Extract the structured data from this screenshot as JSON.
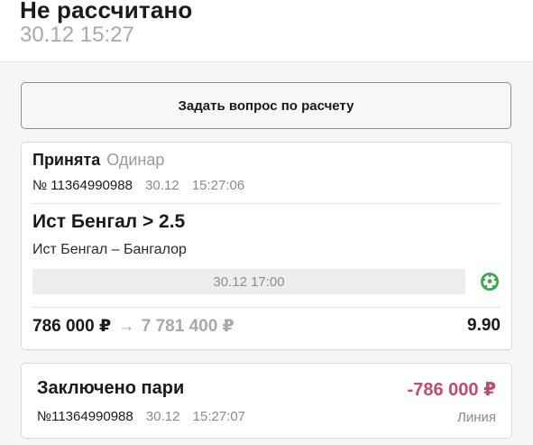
{
  "header": {
    "status_title": "Не рассчитано",
    "status_time": "30.12 15:27"
  },
  "ask_button": {
    "label": "Задать вопрос по расчету"
  },
  "bet": {
    "accepted_label": "Принята",
    "bet_type": "Одинар",
    "number": "№ 11364990988",
    "date": "30.12",
    "time": "15:27:06",
    "selection": "Ист Бенгал > 2.5",
    "event": "Ист Бенгал – Бангалор",
    "event_start": "30.12 17:00",
    "sport_icon": "soccer-ball-icon",
    "stake": "786 000 ₽",
    "arrow": "→",
    "payout": "7 781 400 ₽",
    "coefficient": "9.90"
  },
  "transaction": {
    "title": "Заключено пари",
    "amount": "-786 000 ₽",
    "number": "№11364990988",
    "date": "30.12",
    "time": "15:27:07",
    "source": "Линия"
  },
  "colors": {
    "accent_negative": "#c24a6b",
    "sport_icon_green": "#3aa845",
    "muted_text": "#a9a9ad"
  }
}
